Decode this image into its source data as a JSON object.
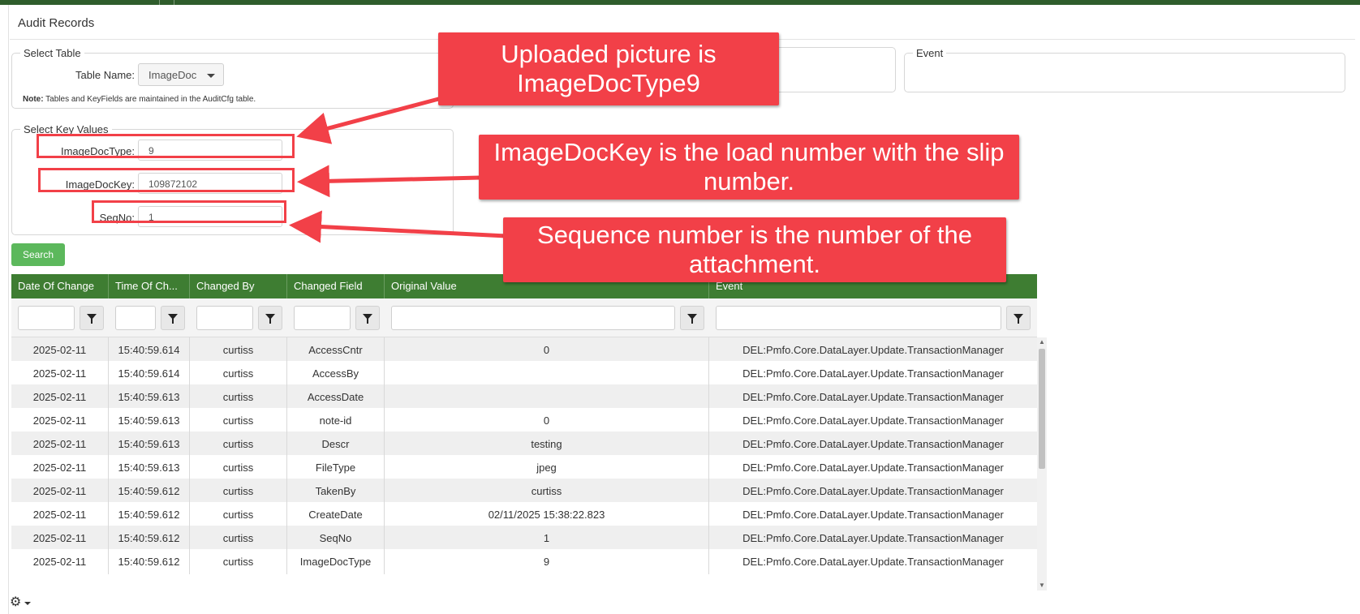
{
  "page": {
    "title": "Audit Records"
  },
  "select_table": {
    "legend": "Select Table",
    "table_name_label": "Table Name:",
    "table_name_value": "ImageDoc",
    "note_bold": "Note:",
    "note_text": " Tables and KeyFields are maintained in the AuditCfg table."
  },
  "event_box": {
    "legend": "Event"
  },
  "key_values": {
    "legend": "Select Key Values",
    "fields": [
      {
        "label": "ImageDocType:",
        "value": "9"
      },
      {
        "label": "ImageDocKey:",
        "value": "109872102"
      },
      {
        "label": "SeqNo:",
        "value": "1"
      }
    ]
  },
  "search_button": "Search",
  "grid": {
    "columns": [
      "Date Of Change",
      "Time Of Ch...",
      "Changed By",
      "Changed Field",
      "Original Value",
      "Event"
    ],
    "rows": [
      [
        "2025-02-11",
        "15:40:59.614",
        "curtiss",
        "AccessCntr",
        "0",
        "DEL:Pmfo.Core.DataLayer.Update.TransactionManager"
      ],
      [
        "2025-02-11",
        "15:40:59.614",
        "curtiss",
        "AccessBy",
        "",
        "DEL:Pmfo.Core.DataLayer.Update.TransactionManager"
      ],
      [
        "2025-02-11",
        "15:40:59.613",
        "curtiss",
        "AccessDate",
        "",
        "DEL:Pmfo.Core.DataLayer.Update.TransactionManager"
      ],
      [
        "2025-02-11",
        "15:40:59.613",
        "curtiss",
        "note-id",
        "0",
        "DEL:Pmfo.Core.DataLayer.Update.TransactionManager"
      ],
      [
        "2025-02-11",
        "15:40:59.613",
        "curtiss",
        "Descr",
        "testing",
        "DEL:Pmfo.Core.DataLayer.Update.TransactionManager"
      ],
      [
        "2025-02-11",
        "15:40:59.613",
        "curtiss",
        "FileType",
        "jpeg",
        "DEL:Pmfo.Core.DataLayer.Update.TransactionManager"
      ],
      [
        "2025-02-11",
        "15:40:59.612",
        "curtiss",
        "TakenBy",
        "curtiss",
        "DEL:Pmfo.Core.DataLayer.Update.TransactionManager"
      ],
      [
        "2025-02-11",
        "15:40:59.612",
        "curtiss",
        "CreateDate",
        "02/11/2025 15:38:22.823",
        "DEL:Pmfo.Core.DataLayer.Update.TransactionManager"
      ],
      [
        "2025-02-11",
        "15:40:59.612",
        "curtiss",
        "SeqNo",
        "1",
        "DEL:Pmfo.Core.DataLayer.Update.TransactionManager"
      ],
      [
        "2025-02-11",
        "15:40:59.612",
        "curtiss",
        "ImageDocType",
        "9",
        "DEL:Pmfo.Core.DataLayer.Update.TransactionManager"
      ]
    ]
  },
  "callouts": [
    {
      "text": "Uploaded picture is ImageDocType9"
    },
    {
      "text": "ImageDocKey is the load number with the slip number."
    },
    {
      "text": "Sequence number is the number of the attachment."
    }
  ],
  "icons": {
    "filter": "filter-icon",
    "settings": "gear-icon",
    "dropdown": "chevron-down-icon"
  },
  "colors": {
    "header_green": "#3e7d32",
    "top_bar": "#2f5d2c",
    "search_green": "#5cb85c",
    "callout_red": "#f24048"
  }
}
